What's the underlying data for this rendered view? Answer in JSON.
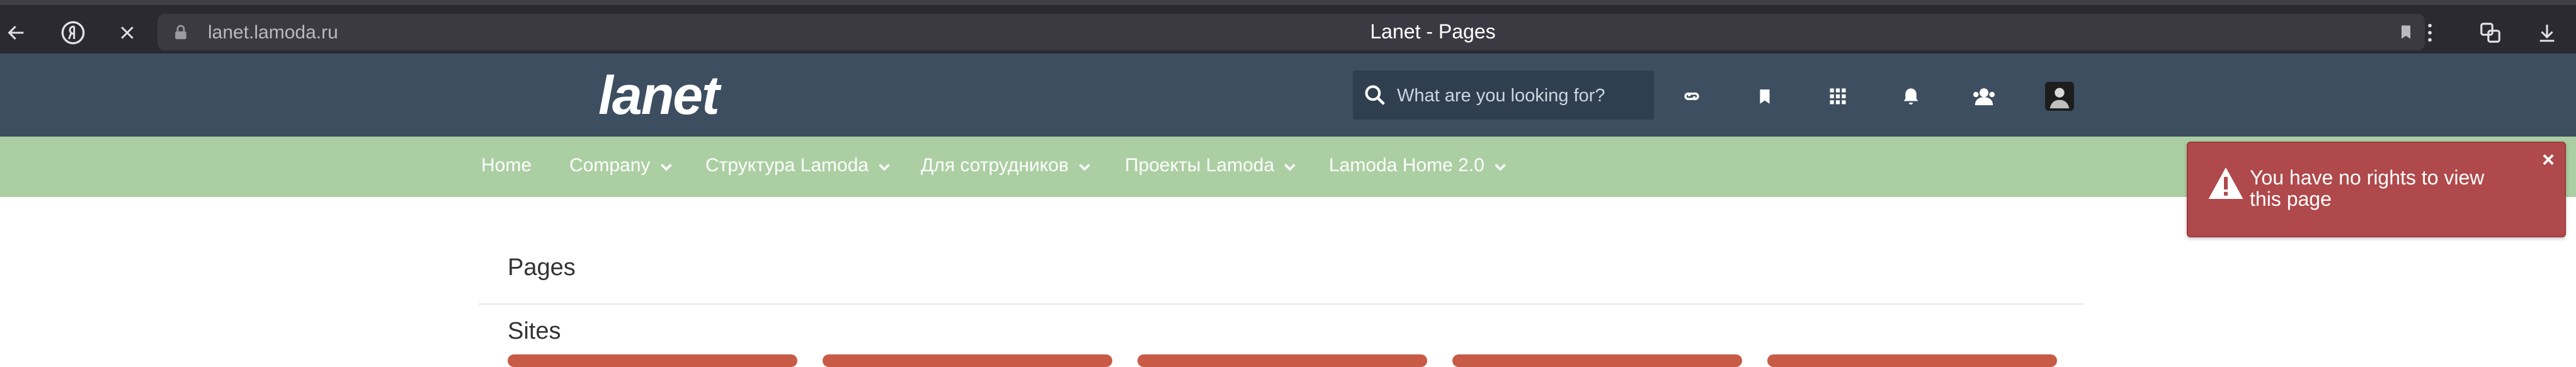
{
  "browser": {
    "url": "lanet.lamoda.ru",
    "tab_title": "Lanet - Pages"
  },
  "header": {
    "logo": "lanet",
    "search_placeholder": "What are you looking for?"
  },
  "nav": {
    "items": [
      {
        "label": "Home"
      },
      {
        "label": "Company"
      },
      {
        "label": "Структура Lamoda"
      },
      {
        "label": "Для сотрудников"
      },
      {
        "label": "Проекты Lamoda"
      },
      {
        "label": "Lamoda Home 2.0"
      }
    ]
  },
  "main": {
    "pages_heading": "Pages",
    "sites_heading": "Sites"
  },
  "toast": {
    "message": "You have no rights to view this page",
    "close": "×"
  },
  "colors": {
    "header_bg": "#3d4e61",
    "nav_bg": "#abcfa2",
    "toast_bg": "#b0494b",
    "card_accent": "#c75b46"
  }
}
